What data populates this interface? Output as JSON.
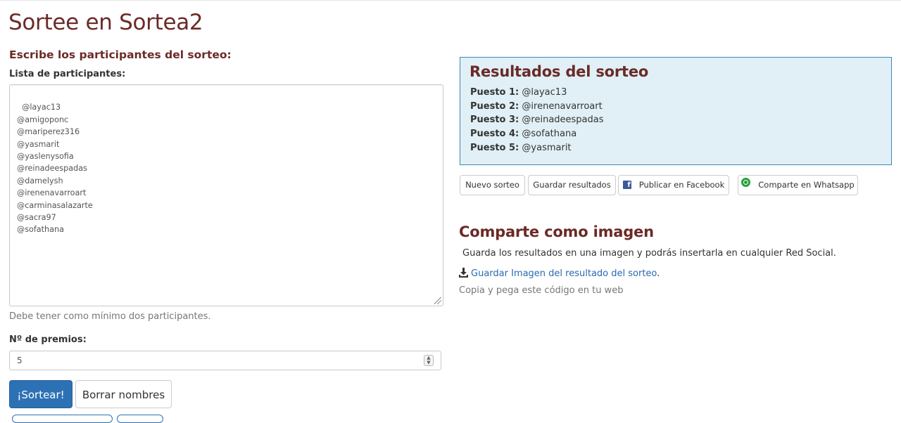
{
  "page": {
    "title": "Sortee en Sortea2",
    "subtitle": "Escribe los participantes del sorteo:"
  },
  "participants": {
    "label": "Lista de participantes:",
    "value": "@layac13\n@amigoponc\n@mariperez316\n@yasmarit\n@yaslenysofia\n@reinadeespadas\n@damelysh\n@irenenavarroart\n@carminasalazarte\n@sacra97\n@sofathana",
    "helper": "Debe tener como mínimo dos participantes."
  },
  "prizes": {
    "label": "Nº de premios:",
    "value": "5"
  },
  "actions": {
    "draw_label": "¡Sortear!",
    "clear_label": "Borrar nombres"
  },
  "results": {
    "title": "Resultados del sorteo",
    "items": [
      {
        "label": "Puesto 1:",
        "value": "@layac13"
      },
      {
        "label": "Puesto 2:",
        "value": "@irenenavarroart"
      },
      {
        "label": "Puesto 3:",
        "value": "@reinadeespadas"
      },
      {
        "label": "Puesto 4:",
        "value": "@sofathana"
      },
      {
        "label": "Puesto 5:",
        "value": "@yasmarit"
      }
    ]
  },
  "result_actions": {
    "new_draw": "Nuevo sorteo",
    "save_results": "Guardar resultados",
    "facebook": "Publicar en Facebook",
    "whatsapp": "Comparte en Whatsapp"
  },
  "share_image": {
    "title": "Comparte como imagen",
    "description": "Guarda los resultados en una imagen y podrás insertarla en cualquier Red Social.",
    "download_link": "Guardar Imagen del resultado del sorteo",
    "download_suffix": ".",
    "copy_text": "Copia y pega este código en tu web"
  },
  "colors": {
    "heading": "#6b2a27",
    "primary": "#2d71b5",
    "results_bg": "#e0f0f6",
    "link": "#2a6ab0"
  },
  "icons": {
    "facebook": "facebook-icon",
    "whatsapp": "whatsapp-icon",
    "download": "download-icon",
    "spinner": "spinner-arrows-icon",
    "resize": "resize-grip-icon"
  }
}
